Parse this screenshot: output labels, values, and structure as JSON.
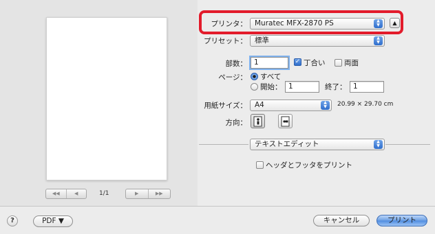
{
  "preview": {
    "page_indicator": "1/1",
    "nav_buttons": [
      "◀◀",
      "◀",
      "▶",
      "▶▶"
    ]
  },
  "printer": {
    "label": "プリンタ：",
    "value": "Muratec MFX-2870 PS"
  },
  "preset": {
    "label": "プリセット：",
    "value": "標準"
  },
  "copies": {
    "label": "部数：",
    "value": "1",
    "collated_label": "丁合い",
    "collated_checked": true,
    "duplex_label": "両面",
    "duplex_checked": false
  },
  "pages": {
    "label": "ページ：",
    "all_label": "すべて",
    "from_label": "開始：",
    "from_value": "1",
    "to_label": "終了：",
    "to_value": "1",
    "selected": "all"
  },
  "paper": {
    "label": "用紙サイズ：",
    "value": "A4",
    "dimensions": "20.99 × 29.70 cm"
  },
  "orientation": {
    "label": "方向：",
    "selected": "portrait"
  },
  "app_section": {
    "value": "テキストエディット",
    "header_footer_label": "ヘッダとフッタをプリント",
    "header_footer_checked": false
  },
  "footer": {
    "help": "?",
    "pdf_label": "PDF ▼",
    "cancel_label": "キャンセル",
    "print_label": "プリント"
  },
  "colors": {
    "highlight": "#e21b2b",
    "accent": "#4f8ce0"
  }
}
